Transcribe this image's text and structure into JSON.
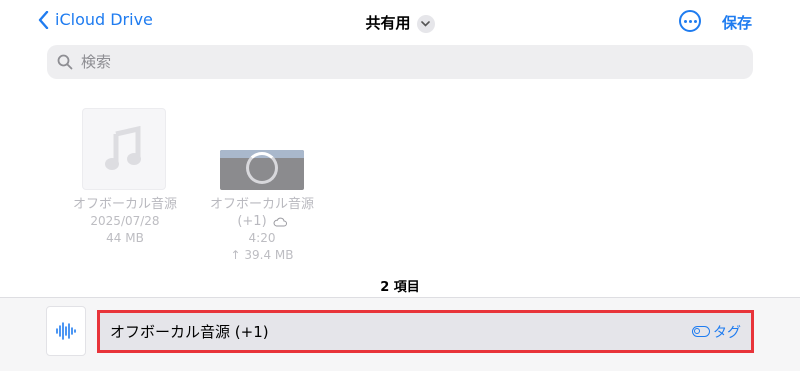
{
  "header": {
    "back_label": "iCloud Drive",
    "title": "共有用",
    "save_label": "保存"
  },
  "search": {
    "placeholder": "検索"
  },
  "files": [
    {
      "name": "オフボーカル音源",
      "date": "2025/07/28",
      "size": "44 MB",
      "icon": "music-note-icon"
    },
    {
      "name": "オフボーカル音源",
      "name_suffix": "(+1)",
      "duration": "4:20",
      "size": "↑ 39.4 MB",
      "status": "uploading",
      "icon": "cloud-icon"
    }
  ],
  "item_count": "2 項目",
  "save_panel": {
    "file_name": "オフボーカル音源 (+1)",
    "tag_label": "タグ",
    "icon": "waveform-icon"
  },
  "colors": {
    "accent": "#1f7cf0",
    "highlight": "#e8343a"
  }
}
